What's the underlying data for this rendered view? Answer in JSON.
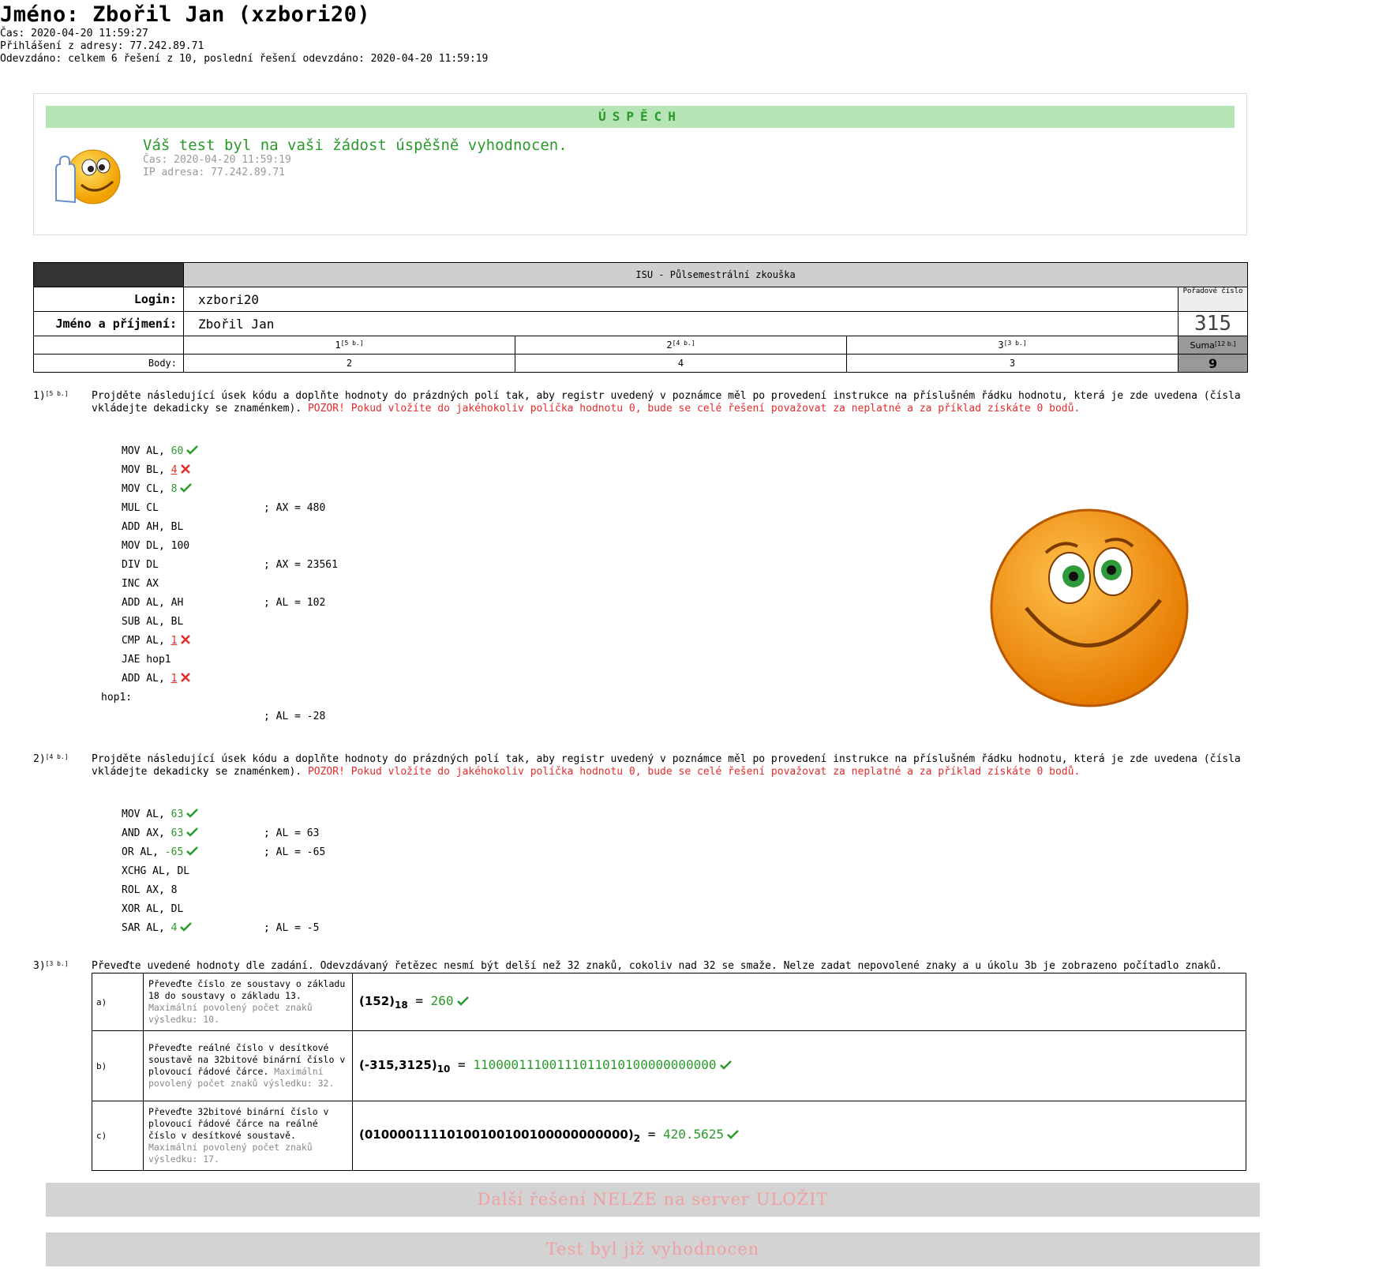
{
  "header": {
    "title": "Jméno: Zbořil Jan (xzbori20)",
    "time": "Čas: 2020-04-20 11:59:27",
    "login_from": "Přihlášení z adresy: 77.242.89.71",
    "submitted": "Odevzdáno: celkem 6 řešení z 10, poslední řešení odevzdáno: 2020-04-20 11:59:19"
  },
  "success": {
    "banner": "ÚSPĚCH",
    "message": "Váš test byl na vaši žádost úspěšně vyhodnocen.",
    "time": "Čas: 2020-04-20 11:59:19",
    "ip": "IP adresa: 77.242.89.71"
  },
  "info": {
    "title": "ISU - Půlsemestrální zkouška",
    "login_label": "Login:",
    "login": "xzbori20",
    "name_label": "Jméno a příjmení:",
    "name": "Zbořil Jan",
    "order_label": "Pořadové číslo",
    "order": "315",
    "cols": [
      {
        "n": "1",
        "pts": "[5 b.]"
      },
      {
        "n": "2",
        "pts": "[4 b.]"
      },
      {
        "n": "3",
        "pts": "[3 b.]"
      }
    ],
    "sum_label": "Suma",
    "sum_pts": "[12 b.]",
    "points_label": "Body:",
    "points": [
      "2",
      "4",
      "3"
    ],
    "sum": "9"
  },
  "q1": {
    "num": "1)",
    "pts": "[5 b.]",
    "text": "Projděte následující úsek kódu a doplňte hodnoty do prázdných polí tak, aby registr uvedený v poznámce měl po provedení instrukce na příslušném řádku hodnotu, která je zde uvedena (čísla vkládejte dekadicky se znaménkem). ",
    "warn": "POZOR! Pokud vložíte do jakéhokoliv políčka hodnotu 0, bude se celé řešení považovat za neplatné a za příklad získáte 0 bodů.",
    "code": [
      {
        "t": "MOV AL, ",
        "v": "60",
        "s": "ok",
        "c": ""
      },
      {
        "t": "MOV BL, ",
        "v": "4",
        "s": "bad",
        "c": ""
      },
      {
        "t": "MOV CL, ",
        "v": "8",
        "s": "ok",
        "c": ""
      },
      {
        "t": "MUL CL",
        "v": "",
        "s": "",
        "c": "; AX = 480"
      },
      {
        "t": "ADD AH, BL",
        "v": "",
        "s": "",
        "c": ""
      },
      {
        "t": "MOV DL, 100",
        "v": "",
        "s": "",
        "c": ""
      },
      {
        "t": "DIV DL",
        "v": "",
        "s": "",
        "c": "; AX = 23561"
      },
      {
        "t": "INC AX",
        "v": "",
        "s": "",
        "c": ""
      },
      {
        "t": "ADD AL, AH",
        "v": "",
        "s": "",
        "c": "; AL = 102"
      },
      {
        "t": "SUB AL, BL",
        "v": "",
        "s": "",
        "c": ""
      },
      {
        "t": "CMP AL, ",
        "v": "1",
        "s": "bad",
        "c": ""
      },
      {
        "t": "JAE hop1",
        "v": "",
        "s": "",
        "c": ""
      },
      {
        "t": "ADD AL, ",
        "v": "1",
        "s": "bad",
        "c": ""
      }
    ],
    "label": "hop1:",
    "final": "; AL = -28"
  },
  "q2": {
    "num": "2)",
    "pts": "[4 b.]",
    "text": "Projděte následující úsek kódu a doplňte hodnoty do prázdných polí tak, aby registr uvedený v poznámce měl po provedení instrukce na příslušném řádku hodnotu, která je zde uvedena (čísla vkládejte dekadicky se znaménkem). ",
    "warn": "POZOR! Pokud vložíte do jakéhokoliv políčka hodnotu 0, bude se celé řešení považovat za neplatné a za příklad získáte 0 bodů.",
    "code": [
      {
        "t": "MOV AL, ",
        "v": "63",
        "s": "ok",
        "c": ""
      },
      {
        "t": "AND AX, ",
        "v": "63",
        "s": "ok",
        "c": "; AL = 63"
      },
      {
        "t": "OR AL, ",
        "v": "-65",
        "s": "ok",
        "c": "; AL = -65"
      },
      {
        "t": "XCHG AL, DL",
        "v": "",
        "s": "",
        "c": ""
      },
      {
        "t": "ROL AX, 8",
        "v": "",
        "s": "",
        "c": ""
      },
      {
        "t": "XOR AL, DL",
        "v": "",
        "s": "",
        "c": ""
      },
      {
        "t": "SAR AL, ",
        "v": "4",
        "s": "ok",
        "c": "; AL = -5"
      }
    ]
  },
  "q3": {
    "num": "3)",
    "pts": "[3 b.]",
    "text": "Převeďte uvedené hodnoty dle zadání. Odevzdávaný řetězec nesmí být delší než 32 znaků, cokoliv nad 32 se smaže. Nelze zadat nepovolené znaky a u úkolu 3b je zobrazeno počítadlo znaků.",
    "rows": [
      {
        "l": "a)",
        "d": "Převeďte číslo ze soustavy o základu 18 do soustavy o základu 13.",
        "g": "Maximální povolený počet znaků výsledku: 10.",
        "n": "(152)",
        "b": "18",
        "r": "260"
      },
      {
        "l": "b)",
        "d": "Převeďte reálné číslo v desítkové soustavě na 32bitové binární číslo v plovoucí řádové čárce.",
        "g": "Maximální povolený počet znaků výsledku: 32.",
        "n": "(-315,3125)",
        "b": "10",
        "r": "11000011100111011010100000000000"
      },
      {
        "l": "c)",
        "d": "Převeďte 32bitové binární číslo v plovoucí řádové čárce na reálné číslo v desítkové soustavě.",
        "g": "Maximální povolený počet znaků výsledku: 17.",
        "n": "(01000011110100100100100000000000)",
        "b": "2",
        "r": "420.5625"
      }
    ]
  },
  "buttons": {
    "save": "Další řešení NELZE na server ULOŽIT",
    "evaluated": "Test byl již vyhodnocen"
  },
  "colors": {
    "ok": "#2a9a2a",
    "bad": "#e52b2b",
    "success_bar": "#b5e5b5"
  }
}
